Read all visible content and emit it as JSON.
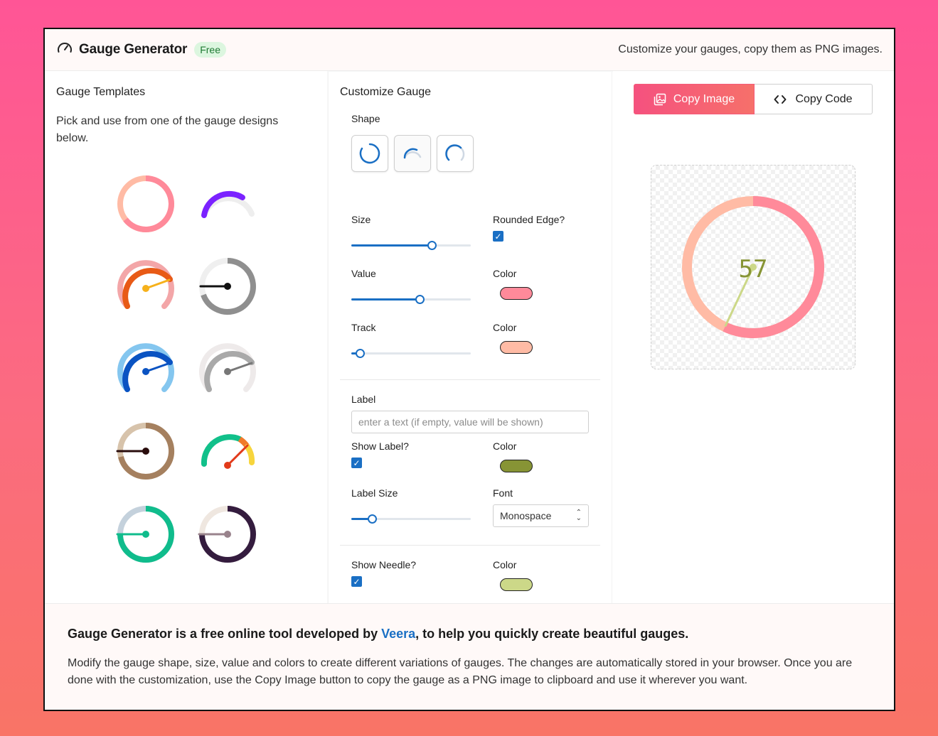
{
  "header": {
    "title": "Gauge Generator",
    "badge": "Free",
    "tagline": "Customize your gauges, copy them as PNG images."
  },
  "templates": {
    "title": "Gauge Templates",
    "description": "Pick and use from one of the gauge designs below."
  },
  "customize": {
    "title": "Customize Gauge",
    "shape_label": "Shape",
    "size_label": "Size",
    "size_value": 0.67,
    "rounded_label": "Rounded Edge?",
    "rounded_checked": true,
    "value_label": "Value",
    "value_value": 0.57,
    "value_color_label": "Color",
    "value_color": "#ff8a9a",
    "track_label": "Track",
    "track_value": 0.07,
    "track_color_label": "Color",
    "track_color": "#ffbba5",
    "label_label": "Label",
    "label_placeholder": "enter a text (if empty, value will be shown)",
    "show_label_label": "Show Label?",
    "show_label_checked": true,
    "label_color_label": "Color",
    "label_color": "#879435",
    "label_size_label": "Label Size",
    "label_size_value": 0.17,
    "font_label": "Font",
    "font_value": "Monospace",
    "show_needle_label": "Show Needle?",
    "show_needle_checked": true,
    "needle_color_label": "Color",
    "needle_color": "#ccd888"
  },
  "actions": {
    "copy_image": "Copy Image",
    "copy_code": "Copy Code"
  },
  "preview": {
    "value": "57",
    "value_color": "#ff8a9a",
    "track_color": "#ffbba5",
    "label_color": "#879435",
    "needle_color": "#ccd888"
  },
  "footer": {
    "title_before": "Gauge Generator is a free online tool developed by ",
    "title_link": "Veera",
    "title_after": ", to help you quickly create beautiful gauges.",
    "text": "Modify the gauge shape, size, value and colors to create different variations of gauges. The changes are automatically stored in your browser. Once you are done with the customization, use the Copy Image button to copy the gauge as a PNG image to clipboard and use it wherever you want."
  }
}
